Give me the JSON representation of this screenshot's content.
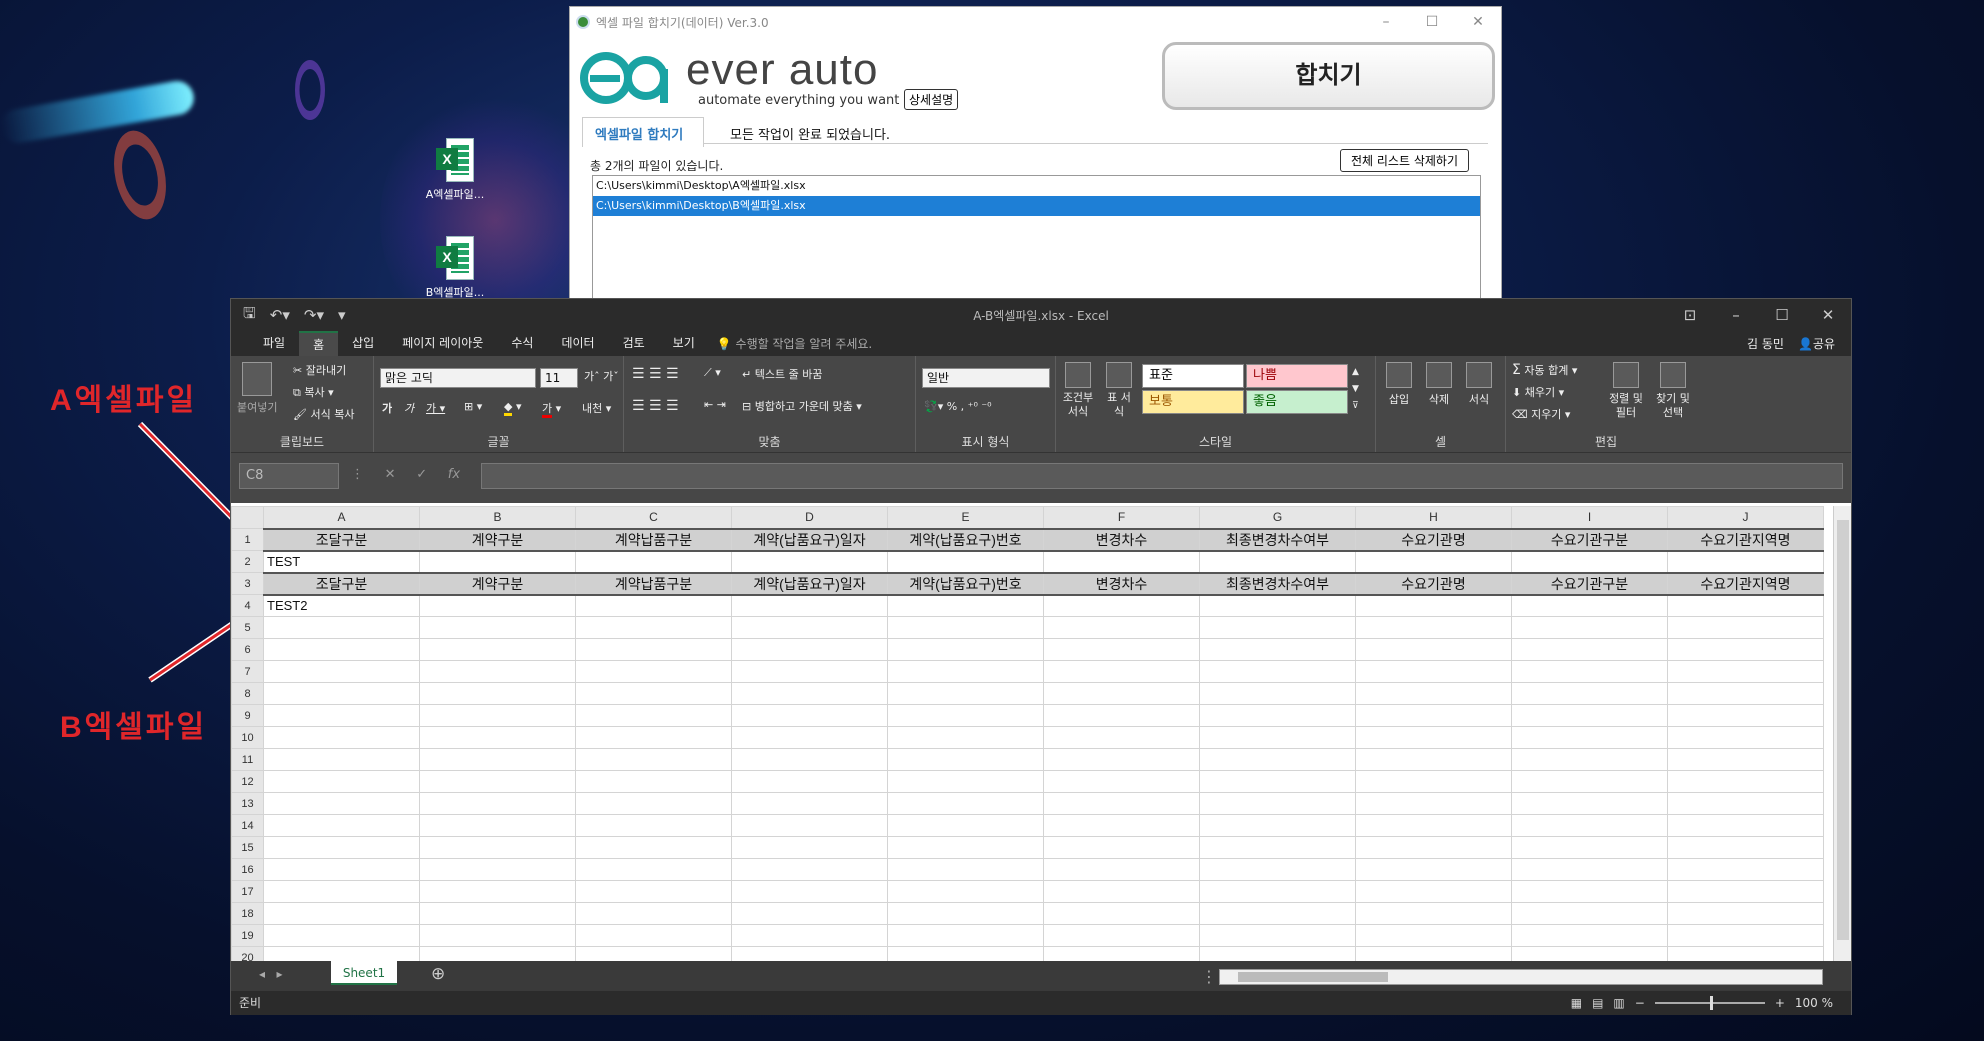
{
  "desktop": {
    "icons": [
      {
        "label": "A엑셀파일...",
        "badge": "X"
      },
      {
        "label": "B엑셀파일...",
        "badge": "X"
      }
    ],
    "annotations": {
      "a": "A엑셀파일",
      "b": "B엑셀파일"
    },
    "annotation_color": "#e0262a"
  },
  "merger": {
    "title": "엑셀 파일 합치기(데이터) Ver.3.0",
    "logo_text": "ever auto",
    "tagline": "automate everything you want",
    "detail_button": "상세설명",
    "merge_button": "합치기",
    "tab": "엑셀파일 합치기",
    "status": "모든 작업이 완료 되었습니다.",
    "file_count": "총 2개의 파일이 있습니다.",
    "clear_button": "전체 리스트 삭제하기",
    "files": [
      "C:\\Users\\kimmi\\Desktop\\A엑셀파일.xlsx",
      "C:\\Users\\kimmi\\Desktop\\B엑셀파일.xlsx"
    ],
    "selected_index": 1,
    "accent": "#2f7bbf"
  },
  "excel": {
    "title": "A-B엑셀파일.xlsx - Excel",
    "menu": [
      "파일",
      "홈",
      "삽입",
      "페이지 레이아웃",
      "수식",
      "데이터",
      "검토",
      "보기"
    ],
    "active_menu": "홈",
    "tell_me": "수행할 작업을 알려 주세요.",
    "user": "김 동민",
    "share": "공유",
    "ribbon": {
      "clipboard": {
        "paste": "붙여넣기",
        "cut": "잘라내기",
        "copy": "복사",
        "format_painter": "서식 복사",
        "label": "클립보드"
      },
      "font": {
        "name": "맑은 고딕",
        "size": "11",
        "label": "글꼴",
        "phonetic": "내천"
      },
      "align": {
        "wrap": "텍스트 줄 바꿈",
        "merge": "병합하고 가운데 맞춤",
        "label": "맞춤"
      },
      "number": {
        "format": "일반",
        "label": "표시 형식"
      },
      "styles": {
        "cond": "조건부 서식",
        "table": "표 서식",
        "normal": "표준",
        "bad": "나쁨",
        "neutral": "보통",
        "good": "좋음",
        "label": "스타일"
      },
      "cells": {
        "insert": "삽입",
        "delete": "삭제",
        "format": "서식",
        "label": "셀"
      },
      "edit": {
        "autosum": "자동 합계",
        "fill": "채우기",
        "clear": "지우기",
        "sort": "정렬 및 필터",
        "find": "찾기 및 선택",
        "label": "편집"
      }
    },
    "name_box": "C8",
    "columns": [
      "A",
      "B",
      "C",
      "D",
      "E",
      "F",
      "G",
      "H",
      "I",
      "J"
    ],
    "header_row": [
      "조달구분",
      "계약구분",
      "계약납품구분",
      "계약(납품요구)일자",
      "계약(납품요구)번호",
      "변경차수",
      "최종변경차수여부",
      "수요기관명",
      "수요기관구분",
      "수요기관지역명"
    ],
    "rows": [
      {
        "num": "1",
        "type": "header"
      },
      {
        "num": "2",
        "cells": [
          "TEST",
          "",
          "",
          "",
          "",
          "",
          "",
          "",
          "",
          ""
        ]
      },
      {
        "num": "3",
        "type": "header"
      },
      {
        "num": "4",
        "cells": [
          "TEST2",
          "",
          "",
          "",
          "",
          "",
          "",
          "",
          "",
          ""
        ]
      },
      {
        "num": "5"
      },
      {
        "num": "6"
      },
      {
        "num": "7"
      },
      {
        "num": "8"
      },
      {
        "num": "9"
      },
      {
        "num": "10"
      },
      {
        "num": "11"
      },
      {
        "num": "12"
      },
      {
        "num": "13"
      },
      {
        "num": "14"
      },
      {
        "num": "15"
      },
      {
        "num": "16"
      },
      {
        "num": "17"
      },
      {
        "num": "18"
      },
      {
        "num": "19"
      },
      {
        "num": "20"
      }
    ],
    "sheet_tab": "Sheet1",
    "status": "준비",
    "zoom": "100 %"
  }
}
